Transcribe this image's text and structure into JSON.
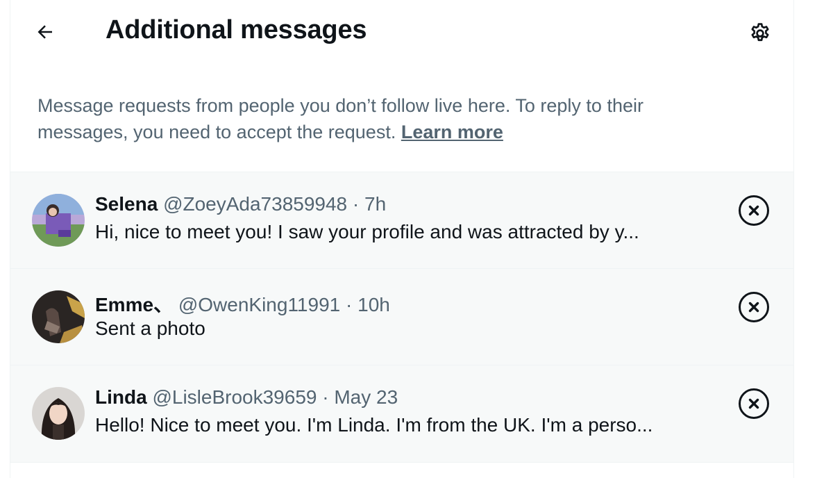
{
  "header": {
    "title": "Additional messages",
    "back_icon": "arrow-left-icon",
    "settings_icon": "gear-icon"
  },
  "intro": {
    "text": "Message requests from people you don’t follow live here. To reply to their messages, you need to accept the request.",
    "link": "Learn more"
  },
  "requests": [
    {
      "name": "Selena",
      "handle": "@ZoeyAda73859948",
      "separator": "·",
      "time": "7h",
      "preview": "Hi, nice to meet you! I saw your profile and was attracted by y...",
      "dismiss_icon": "close-circle-icon"
    },
    {
      "name": "Emme、",
      "handle": "@OwenKing11991",
      "separator": "·",
      "time": "10h",
      "preview": "Sent a photo",
      "dismiss_icon": "close-circle-icon"
    },
    {
      "name": "Linda",
      "handle": "@LisleBrook39659",
      "separator": "·",
      "time": "May 23",
      "preview": "Hello! Nice to meet you. I'm Linda. I'm from the UK. I'm a perso...",
      "dismiss_icon": "close-circle-icon"
    }
  ],
  "colors": {
    "text_primary": "#0f1419",
    "text_secondary": "#536471",
    "row_background": "#f7f9f9",
    "divider": "#eff3f4"
  }
}
